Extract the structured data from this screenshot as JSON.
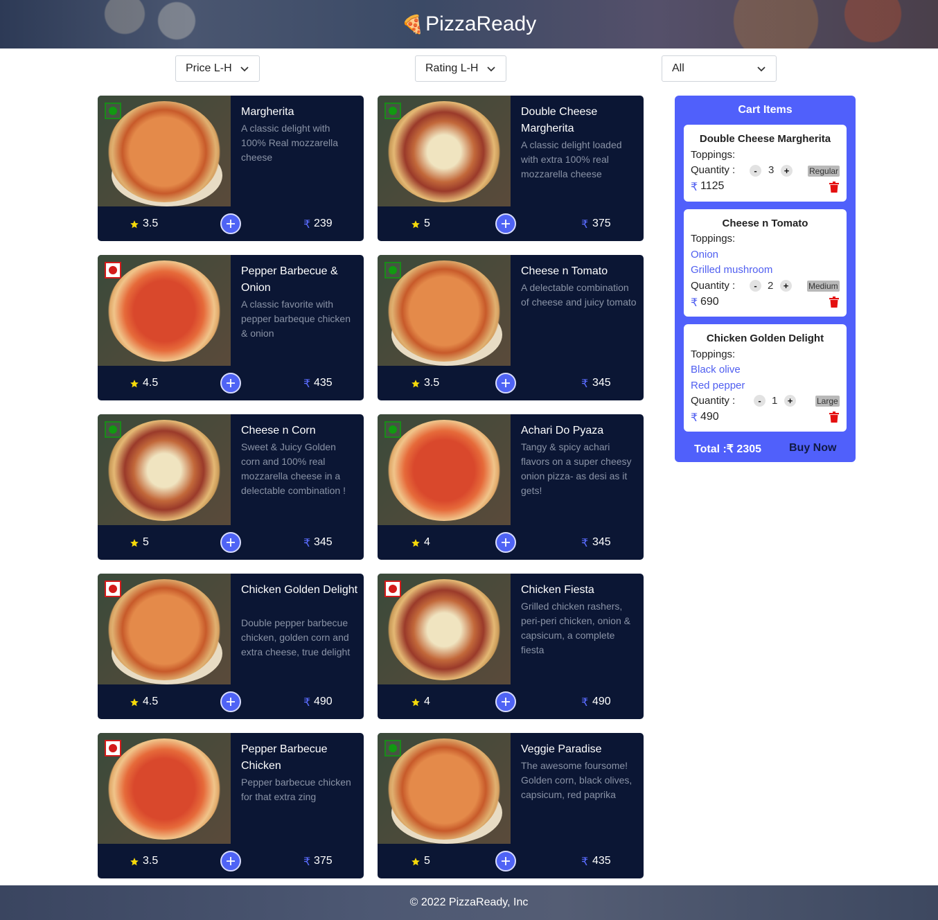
{
  "header": {
    "brand": "PizzaReady",
    "brand_icon": "pizza-icon"
  },
  "filters": {
    "price": "Price L-H",
    "rating": "Rating L-H",
    "type": "All"
  },
  "currency": "₹",
  "pizzas": [
    {
      "name": "Margherita",
      "desc": "A classic delight with 100% Real mozzarella cheese",
      "rating": "3.5",
      "price": "239",
      "veg": true
    },
    {
      "name": "Double Cheese Margherita",
      "desc": "A classic delight loaded with extra 100% real mozzarella cheese",
      "rating": "5",
      "price": "375",
      "veg": true
    },
    {
      "name": "Pepper Barbecue & Onion",
      "desc": "A classic favorite with pepper barbeque chicken & onion",
      "rating": "4.5",
      "price": "435",
      "veg": false
    },
    {
      "name": "Cheese n Tomato",
      "desc": "A delectable combination of cheese and juicy tomato",
      "rating": "3.5",
      "price": "345",
      "veg": true
    },
    {
      "name": "Cheese n Corn",
      "desc": "Sweet & Juicy Golden corn and 100% real mozzarella cheese in a delectable combination !",
      "rating": "5",
      "price": "345",
      "veg": true
    },
    {
      "name": "Achari Do Pyaza",
      "desc": "Tangy & spicy achari flavors on a super cheesy onion pizza- as desi as it gets!",
      "rating": "4",
      "price": "345",
      "veg": true
    },
    {
      "name": "Chicken Golden Delight",
      "desc": "Double pepper barbecue chicken, golden corn and extra cheese, true delight",
      "rating": "4.5",
      "price": "490",
      "veg": false
    },
    {
      "name": "Chicken Fiesta",
      "desc": "Grilled chicken rashers, peri-peri chicken, onion & capsicum, a complete fiesta",
      "rating": "4",
      "price": "490",
      "veg": false
    },
    {
      "name": "Pepper Barbecue Chicken",
      "desc": "Pepper barbecue chicken for that extra zing",
      "rating": "3.5",
      "price": "375",
      "veg": false
    },
    {
      "name": "Veggie Paradise",
      "desc": "The awesome foursome! Golden corn, black olives, capsicum, red paprika",
      "rating": "5",
      "price": "435",
      "veg": true
    }
  ],
  "cart": {
    "title": "Cart Items",
    "toppings_label": "Toppings:",
    "quantity_label": "Quantity :",
    "minus": "-",
    "plus": "+",
    "items": [
      {
        "name": "Double Cheese Margherita",
        "toppings": [],
        "qty": "3",
        "size": "Regular",
        "amount": "1125"
      },
      {
        "name": "Cheese n Tomato",
        "toppings": [
          "Onion",
          "Grilled mushroom"
        ],
        "qty": "2",
        "size": "Medium",
        "amount": "690"
      },
      {
        "name": "Chicken Golden Delight",
        "toppings": [
          "Black olive",
          "Red pepper"
        ],
        "qty": "1",
        "size": "Large",
        "amount": "490"
      }
    ],
    "total": "Total :₹ 2305",
    "buy": "Buy Now"
  },
  "footer": {
    "text": "© 2022 PizzaReady, Inc"
  },
  "colors": {
    "card_bg": "#0b1634",
    "accent": "#5060fb",
    "veg": "#119911",
    "nonveg": "#d31a1a",
    "star": "#f5d90a"
  }
}
